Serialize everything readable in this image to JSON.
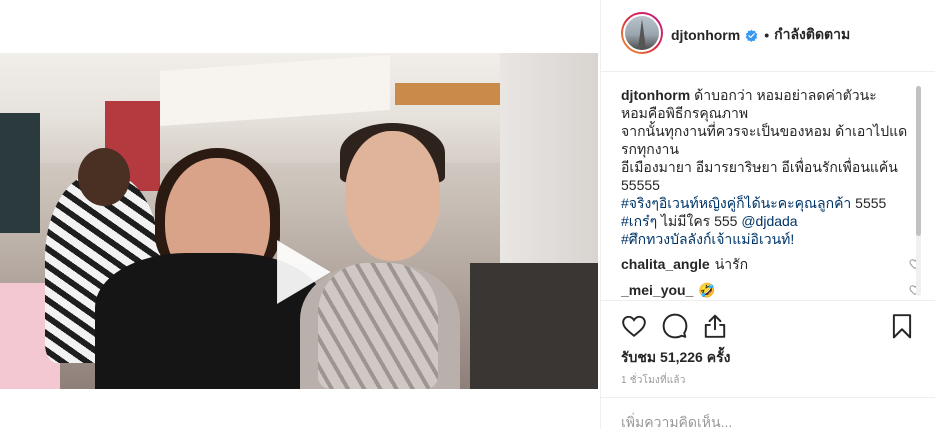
{
  "header": {
    "username": "djtonhorm",
    "separator": "•",
    "follow_label": "กำลังติดตาม"
  },
  "caption": {
    "username": "djtonhorm",
    "lines": [
      "ด้าบอกว่า หอมอย่าลดค่าตัวนะ",
      "หอมคือพิธีกรคุณภาพ",
      "จากนั้นทุกงานที่ควรจะเป็นของหอม ด้าเอาไปแด",
      "รกทุกงาน",
      "อีเมืองมายา อีมารยาริษยา อีเพื่อนรักเพื่อนแค้น",
      "55555"
    ],
    "tag_line_1": "#จริงๆอิเวนท์หญิงคู่ก็ได้นะคะคุณลูกค้า",
    "tag_line_1_tail": " 5555",
    "tag_line_2_tag": "#เกร๋ๆ",
    "tag_line_2_mid": " ไม่มีใคร 555 ",
    "tag_line_2_mention": "@djdada",
    "tag_line_3": "#ศึกทวงบัลลังก์เจ้าแม่อิเวนท์!"
  },
  "comments": [
    {
      "username": "chalita_angle",
      "text": "น่ารัก"
    },
    {
      "username": "_mei_you_",
      "text": "🤣"
    }
  ],
  "stats": {
    "views": "รับชม 51,226 ครั้ง",
    "time": "1 ชั่วโมงที่แล้ว"
  },
  "add_comment_placeholder": "เพิ่มความคิดเห็น...",
  "icons": {
    "verified": "verified-badge-icon",
    "play": "play-icon",
    "like": "heart-icon",
    "comment": "comment-icon",
    "share": "share-icon",
    "save": "bookmark-icon"
  },
  "colors": {
    "verified_blue": "#3897f0",
    "hashtag": "#003569"
  }
}
